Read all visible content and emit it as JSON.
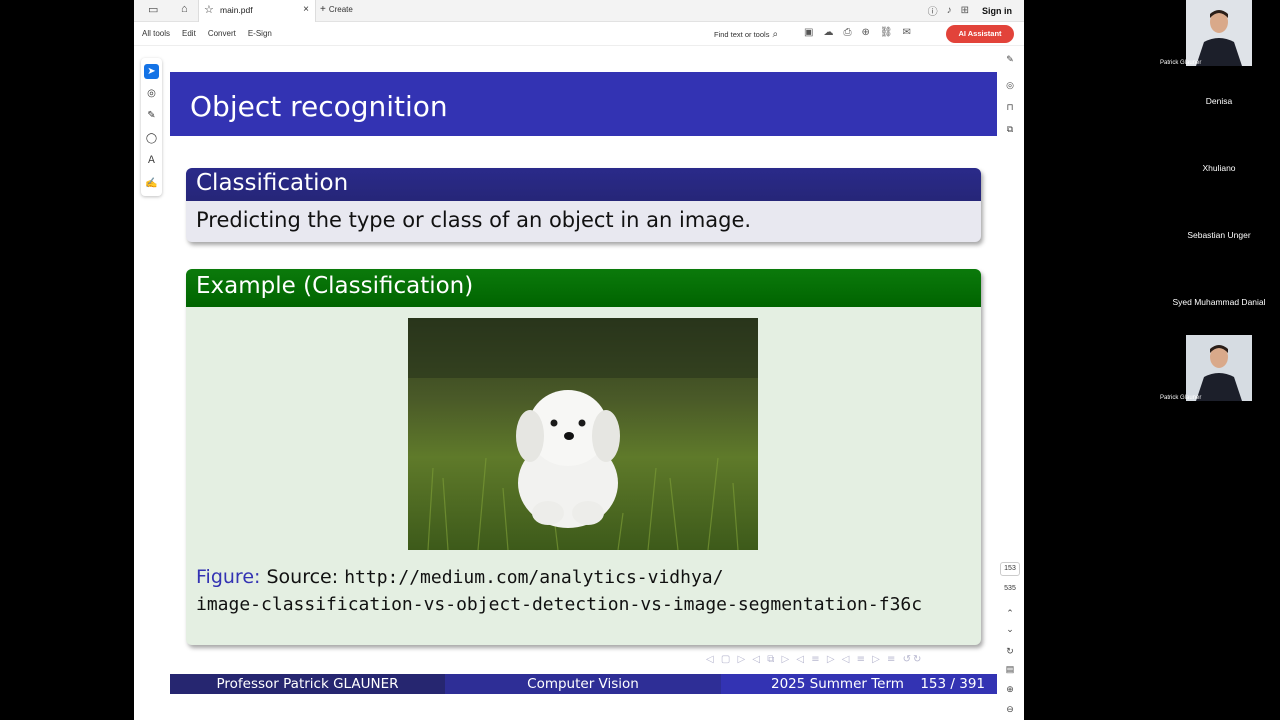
{
  "tabbar": {
    "tab_title": "main.pdf",
    "create_label": "Create",
    "sign_in": "Sign in"
  },
  "toolbar": {
    "menu": [
      "All tools",
      "Edit",
      "Convert",
      "E-Sign"
    ],
    "find_label": "Find text or tools",
    "ai_assistant": "AI Assistant"
  },
  "slide": {
    "title": "Object recognition",
    "block1": {
      "title": "Classification",
      "body": "Predicting the type or class of an object in an image."
    },
    "block2": {
      "title": "Example (Classification)",
      "caption_prefix": "Figure:",
      "caption_source": "Source:",
      "url_line1": "http://medium.com/analytics-vidhya/",
      "url_line2": "image-classification-vs-object-detection-vs-image-segmentation-f36c"
    },
    "footer": {
      "author": "Professor Patrick GLAUNER",
      "course": "Computer Vision",
      "term": "2025 Summer Term",
      "page": "153 / 391"
    }
  },
  "viewer": {
    "current_page": "153",
    "total_pages": "535"
  },
  "participants": [
    "Patrick Glauner",
    "Denisa",
    "Xhuliano",
    "Sebastian Unger",
    "Syed Muhammad Danial",
    "Patrick Glauner"
  ],
  "colors": {
    "frametitle": "#3333b3",
    "block_title_blue": "#262678",
    "block_title_green": "#006400",
    "ai_button": "#e2433a",
    "active_tool": "#1473e6"
  }
}
